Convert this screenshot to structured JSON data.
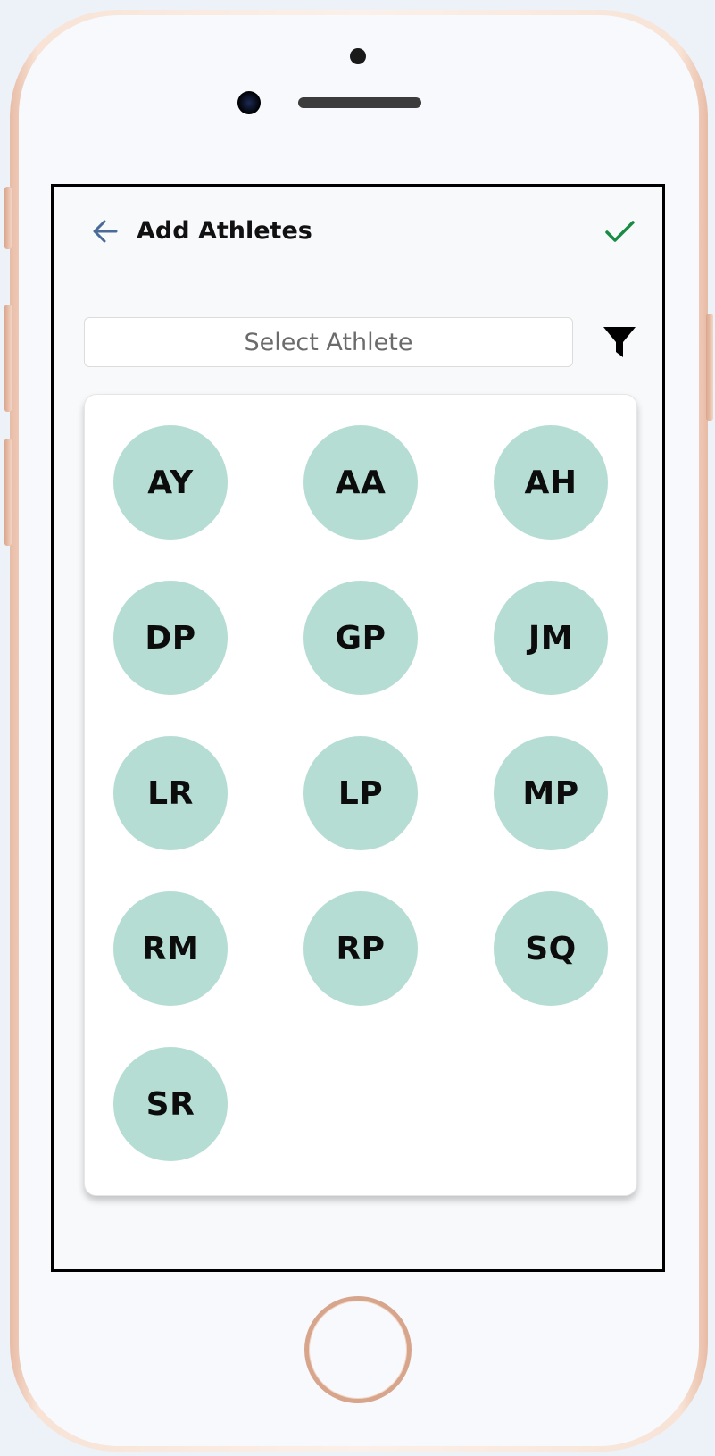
{
  "header": {
    "title": "Add Athletes",
    "back_icon": "arrow-left-icon",
    "confirm_icon": "checkmark-icon",
    "accent_color": "#4a6a99",
    "confirm_color": "#1a8b45"
  },
  "search": {
    "placeholder": "Select Athlete",
    "value": "",
    "filter_icon": "filter-icon"
  },
  "athletes": [
    {
      "initials": "AY"
    },
    {
      "initials": "AA"
    },
    {
      "initials": "AH"
    },
    {
      "initials": "DP"
    },
    {
      "initials": "GP"
    },
    {
      "initials": "JM"
    },
    {
      "initials": "LR"
    },
    {
      "initials": "LP"
    },
    {
      "initials": "MP"
    },
    {
      "initials": "RM"
    },
    {
      "initials": "RP"
    },
    {
      "initials": "SQ"
    },
    {
      "initials": "SR"
    }
  ],
  "colors": {
    "avatar_background": "#b6ddd4"
  }
}
